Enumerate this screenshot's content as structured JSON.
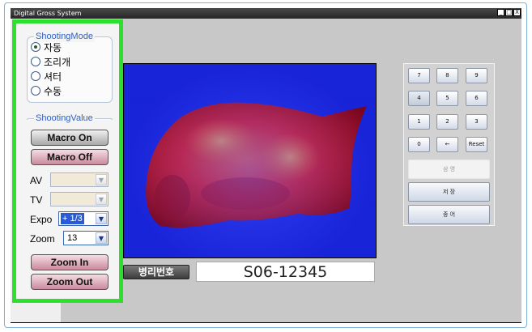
{
  "window": {
    "title": "Digital Gross System",
    "minimize": "_",
    "maximize": "□",
    "close": "X"
  },
  "shooting_mode": {
    "title": "ShootingMode",
    "options": [
      "자동",
      "조리개",
      "셔터",
      "수동"
    ],
    "selected": "자동"
  },
  "shooting_value": {
    "title": "ShootingValue",
    "macro_on": "Macro On",
    "macro_off": "Macro Off",
    "av_label": "AV",
    "av_value": "",
    "tv_label": "TV",
    "tv_value": "",
    "expo_label": "Expo",
    "expo_value": "+ 1/3",
    "zoom_label": "Zoom",
    "zoom_value": "13",
    "zoom_in": "Zoom In",
    "zoom_out": "Zoom Out"
  },
  "specimen": {
    "label": "병리번호",
    "number": "S06-12345"
  },
  "keypad": {
    "keys": [
      "7",
      "8",
      "9",
      "4",
      "5",
      "6",
      "1",
      "2",
      "3",
      "0",
      "←",
      "Reset"
    ],
    "actions": [
      "삼 영",
      "저 장",
      "종 어"
    ]
  },
  "colors": {
    "panel_border": "#2ee02e",
    "image_background": "#1b27e8",
    "group_title": "#3060c0"
  }
}
